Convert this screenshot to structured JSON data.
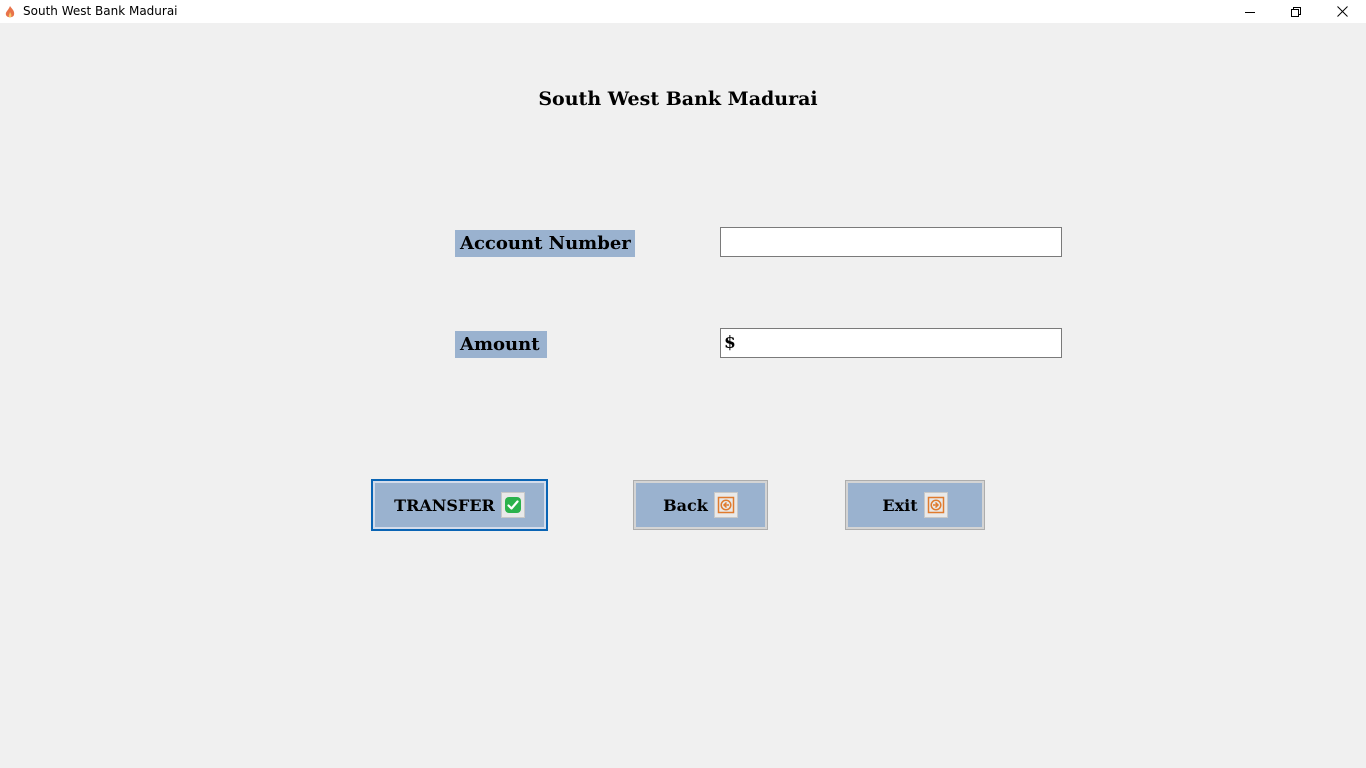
{
  "window": {
    "title": "South West Bank Madurai",
    "icon": "flame-icon",
    "controls": [
      "minimize-icon",
      "restore-icon",
      "close-icon"
    ]
  },
  "form": {
    "heading": "South West Bank Madurai",
    "account_label": "Account Number",
    "account_value": "",
    "amount_label": "Amount",
    "amount_value": "$"
  },
  "buttons": {
    "transfer_label": "TRANSFER",
    "transfer_icon": "check-icon",
    "back_label": "Back",
    "back_icon": "arrow-left-icon",
    "exit_label": "Exit",
    "exit_icon": "arrow-right-icon"
  },
  "colors": {
    "background": "#f0f0f0",
    "label_background": "#9ab2cf",
    "button_background": "#9ab2cf",
    "focus_border": "#0a64b4",
    "check_green": "#2bb24c",
    "arrow_orange": "#e07b2e"
  }
}
